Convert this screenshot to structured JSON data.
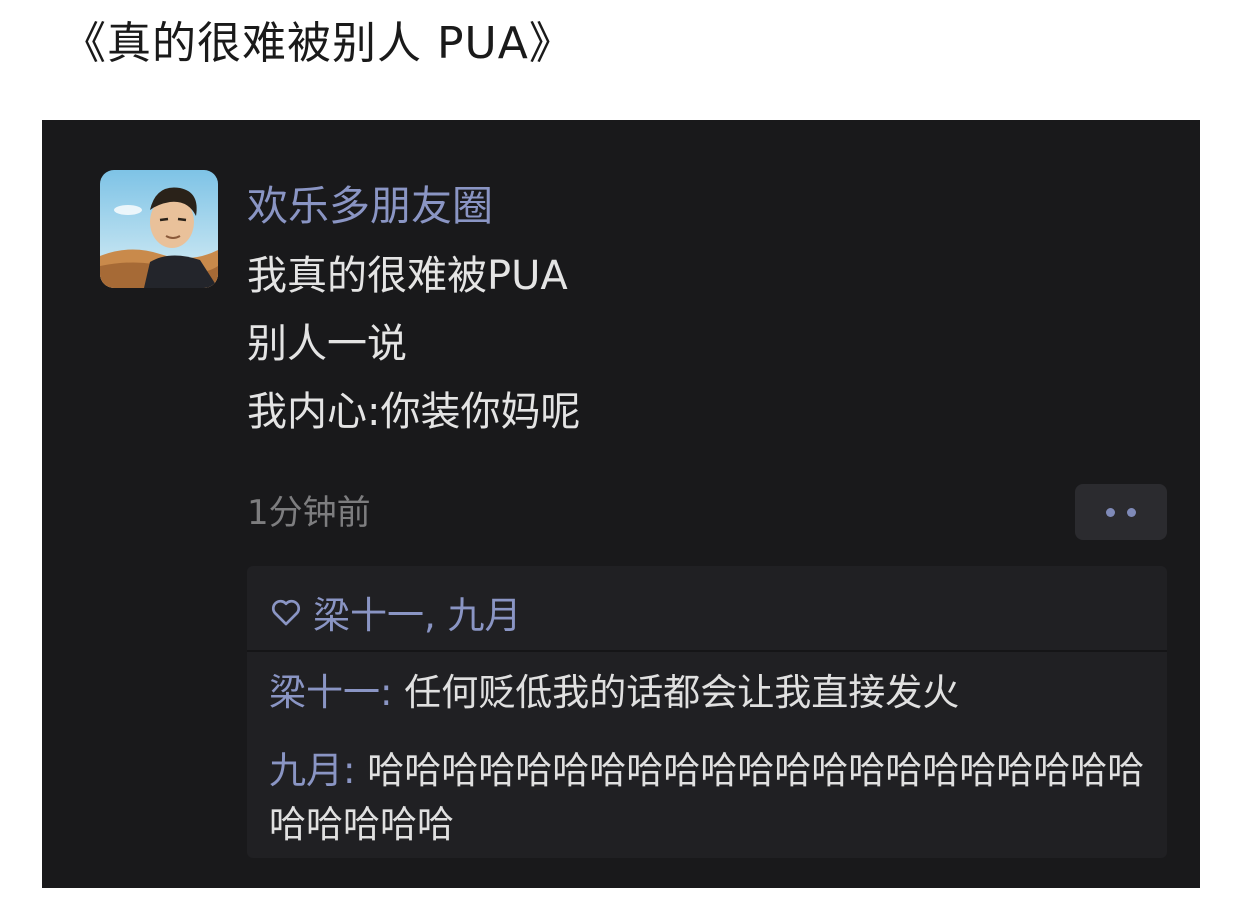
{
  "article": {
    "title": "《真的很难被别人 PUA》"
  },
  "post": {
    "username": "欢乐多朋友圈",
    "lines": [
      "我真的很难被PUA",
      "别人一说",
      "我内心:你装你妈呢"
    ],
    "timestamp": "1分钟前",
    "more_icon": "ellipsis-icon"
  },
  "likes": {
    "icon": "heart-icon",
    "names": "梁十一, 九月"
  },
  "comments": [
    {
      "author": "梁十一",
      "separator": ": ",
      "text": "任何贬低我的话都会让我直接发火"
    },
    {
      "author": "九月",
      "separator": ": ",
      "text": "哈哈哈哈哈哈哈哈哈哈哈哈哈哈哈哈哈哈哈哈哈哈哈哈哈哈"
    }
  ],
  "colors": {
    "background": "#19191b",
    "accent": "#8a95c4",
    "text": "#e4e4e4",
    "muted": "#7d7d7f"
  }
}
